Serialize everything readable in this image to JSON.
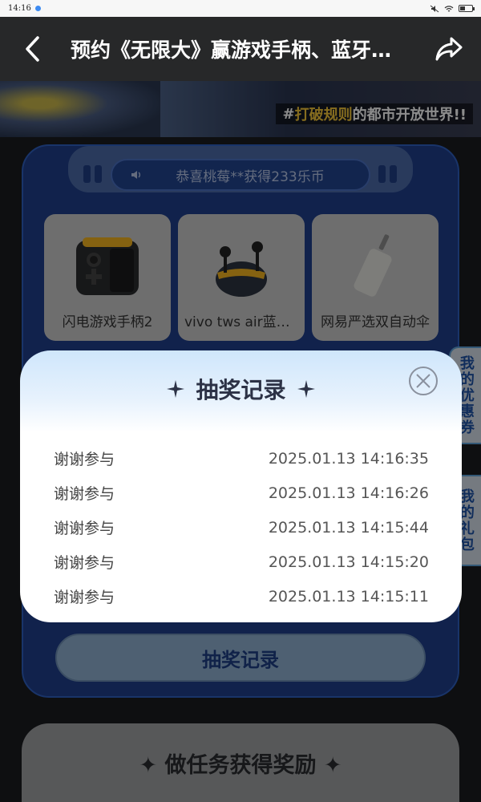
{
  "status_bar": {
    "time": "14:16"
  },
  "header": {
    "title": "预约《无限大》赢游戏手柄、蓝牙耳机等好礼"
  },
  "hero": {
    "slogan_prefix": "#",
    "slogan_highlight": "打破规则",
    "slogan_rest": "的都市开放世界!!"
  },
  "notice": {
    "text": "恭喜桃莓**获得233乐币"
  },
  "prizes": [
    {
      "name": "闪电游戏手柄2"
    },
    {
      "name": "vivo tws air蓝牙耳机"
    },
    {
      "name": "网易严选双自动伞"
    }
  ],
  "draw_record_button": "抽奖记录",
  "task_section_title": "做任务获得奖励",
  "side_tabs": {
    "coupons": "我的优惠券",
    "gifts": "我的礼包"
  },
  "modal": {
    "title": "抽奖记录",
    "records": [
      {
        "result": "谢谢参与",
        "time": "2025.01.13 14:16:35"
      },
      {
        "result": "谢谢参与",
        "time": "2025.01.13 14:16:26"
      },
      {
        "result": "谢谢参与",
        "time": "2025.01.13 14:15:44"
      },
      {
        "result": "谢谢参与",
        "time": "2025.01.13 14:15:20"
      },
      {
        "result": "谢谢参与",
        "time": "2025.01.13 14:15:11"
      }
    ]
  },
  "colors": {
    "primary_blue": "#203f8a",
    "accent_yellow": "#f5c63a"
  }
}
